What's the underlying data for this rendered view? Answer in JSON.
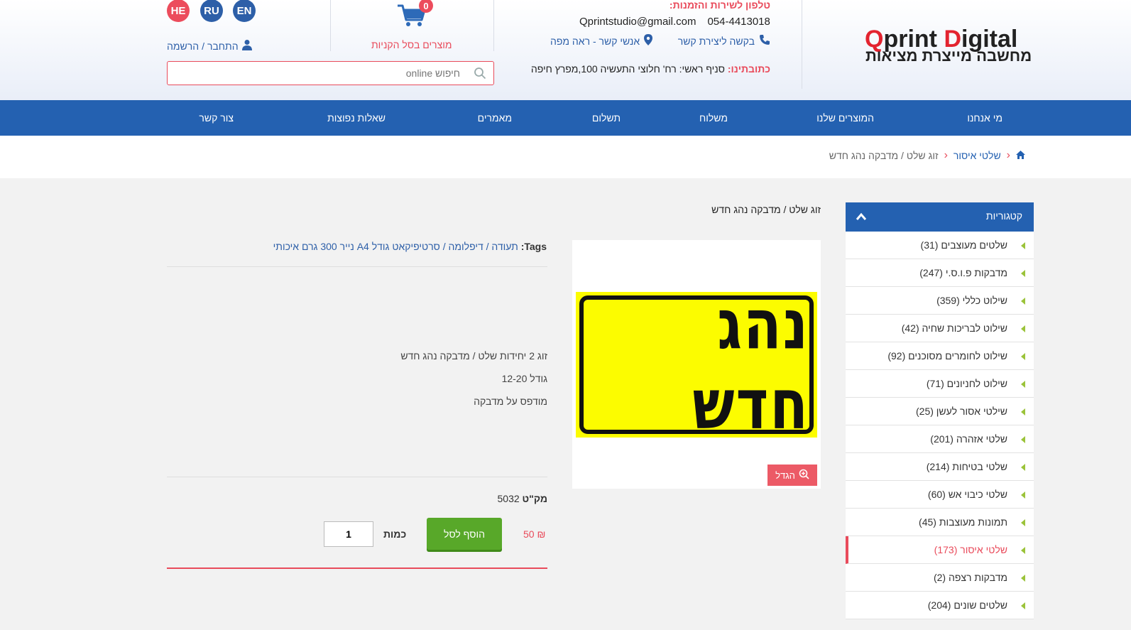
{
  "header": {
    "languages": [
      {
        "code": "HE",
        "color": "#ec4c5c"
      },
      {
        "code": "RU",
        "color": "#2d5fa8"
      },
      {
        "code": "EN",
        "color": "#2d5fa8"
      }
    ],
    "account": {
      "login": "התחבר",
      "separator": "/",
      "register": "הרשמה"
    },
    "cart": {
      "count": "0",
      "label": "מוצרים בסל הקניות"
    },
    "search": {
      "placeholder": "חיפוש online"
    },
    "contact": {
      "phone_title": "טלפון לשירות והזמנות:",
      "phone": "054-4413018",
      "email": "Qprintstudio@gmail.com",
      "callback_link": "בקשה ליצירת קשר",
      "contacts_link": "אנשי קשר - ראה מפה",
      "address_label": "כתובתינו:",
      "address": "סניף ראשי: רח' חלוצי התעשיה 100,מפרץ חיפה"
    },
    "logo": {
      "brand_q": "Q",
      "brand_print": "print ",
      "brand_d": "D",
      "brand_igital": "igital",
      "tagline": "מחשבה מייצרת מציאות"
    }
  },
  "nav": {
    "items": [
      "מי אנחנו",
      "המוצרים שלנו",
      "משלוח",
      "תשלום",
      "מאמרים",
      "שאלות נפוצות",
      "צור קשר"
    ]
  },
  "breadcrumb": {
    "level1": "שלטי איסור",
    "current": "זוג שלט / מדבקה נהג חדש"
  },
  "sidebar": {
    "title": "קטגוריות",
    "categories": [
      {
        "label": "שלטים מעוצבים (31)"
      },
      {
        "label": "מדבקות פ.ו.ס.י (247)"
      },
      {
        "label": "שילוט כללי (359)"
      },
      {
        "label": "שילוט לבריכות שחיה (42)"
      },
      {
        "label": "שילוט לחומרים מסוכנים (92)"
      },
      {
        "label": "שילוט לחניונים (71)"
      },
      {
        "label": "שילטי אסור לעשן (25)"
      },
      {
        "label": "שלטי אזהרה (201)"
      },
      {
        "label": "שלטי בטיחות (214)"
      },
      {
        "label": "שלטי כיבוי אש (60)"
      },
      {
        "label": "תמונות מעוצבות (45)"
      },
      {
        "label": "שלטי איסור (173)",
        "active": true
      },
      {
        "label": "מדבקות רצפה (2)"
      },
      {
        "label": "שלטים שונים (204)"
      }
    ]
  },
  "product": {
    "title": "זוג שלט / מדבקה נהג חדש",
    "tags_label": "Tags",
    "tags": "תעודה / דיפלומה / סרטיפיקאט גודל A4 נייר 300 גרם איכותי",
    "image_text": "נהג חדש",
    "zoom_label": "הגדל",
    "description": [
      "זוג 2 יחידות שלט / מדבקה נהג חדש",
      "גודל 12-20",
      "מודפס על מדבקה"
    ],
    "sku_label": "מק\"ט",
    "sku": "5032",
    "price": "50",
    "currency": "₪",
    "add_to_cart": "הוסף לסל",
    "quantity_label": "כמות",
    "quantity": "1"
  },
  "colors": {
    "brand_blue": "#2461b1",
    "accent_red": "#e94b5b",
    "cta_green": "#58a829",
    "sign_yellow": "#fcfc00"
  }
}
